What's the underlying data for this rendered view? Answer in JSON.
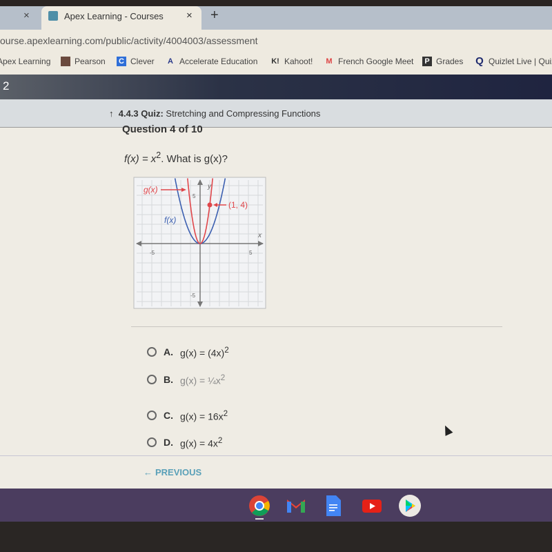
{
  "browser": {
    "tabs": [
      {
        "title": "",
        "close": "×"
      },
      {
        "title": "Apex Learning - Courses",
        "close": "×",
        "active": true
      }
    ],
    "new_tab": "+",
    "url": "ourse.apexlearning.com/public/activity/4004003/assessment",
    "bookmarks": [
      {
        "label": "Apex Learning",
        "icon": "apex-icon"
      },
      {
        "label": "Pearson",
        "icon": "pearson-icon"
      },
      {
        "label": "Clever",
        "icon": "clever-icon"
      },
      {
        "label": "Accelerate Education",
        "icon": "accelerate-icon"
      },
      {
        "label": "Kahoot!",
        "icon": "kahoot-icon"
      },
      {
        "label": "French Google Meet",
        "icon": "gmail-icon"
      },
      {
        "label": "Grades",
        "icon": "powerschool-icon"
      },
      {
        "label": "Quizlet Live | Quiz",
        "icon": "quizlet-icon"
      }
    ]
  },
  "header": {
    "number": "2",
    "breadcrumb_code": "4.4.3",
    "breadcrumb_type": "Quiz:",
    "breadcrumb_title": "Stretching and Compressing Functions"
  },
  "question": {
    "number_label": "Question 4 of 10",
    "prompt_f": "f(x) = x",
    "prompt_exp": "2",
    "prompt_rest": ". What is g(x)?"
  },
  "graph": {
    "labels": {
      "g": "g(x)",
      "f": "f(x)",
      "point": "(1, 4)",
      "x_axis": "x",
      "y_axis": "y"
    },
    "ticks": {
      "x_neg": "-5",
      "x_pos": "5",
      "y_pos": "5",
      "y_neg": "-5"
    },
    "colors": {
      "g": "#e0464a",
      "f": "#3b5fb0"
    }
  },
  "choices": [
    {
      "letter": "A.",
      "text": "g(x) = (4x)",
      "sup": "2"
    },
    {
      "letter": "B.",
      "text": "g(x) = ¼x",
      "sup": "2"
    },
    {
      "letter": "C.",
      "text": "g(x) = 16x",
      "sup": "2"
    },
    {
      "letter": "D.",
      "text": "g(x) = 4x",
      "sup": "2"
    }
  ],
  "nav": {
    "previous": "PREVIOUS"
  },
  "shelf": [
    "chrome",
    "gmail",
    "docs",
    "youtube",
    "play-store"
  ]
}
